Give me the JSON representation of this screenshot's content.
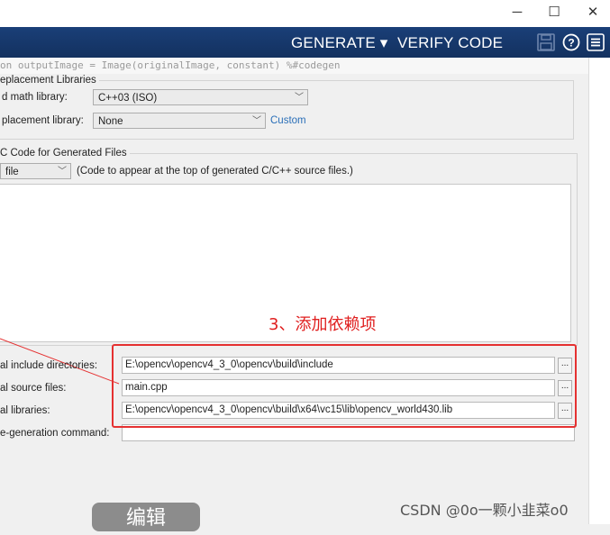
{
  "window": {
    "minimize_glyph": "─",
    "maximize_glyph": "☐",
    "close_glyph": "✕"
  },
  "toolbar": {
    "generate_label": "GENERATE ▾",
    "verify_label": "VERIFY CODE",
    "icons": [
      "save-icon",
      "help-icon",
      "menu-icon"
    ]
  },
  "code_strip": {
    "text": "on outputImage = Image(originalImage, constant) %#codegen"
  },
  "replacement": {
    "group_title": "eplacement Libraries",
    "math_label": "d math library:",
    "math_value": "C++03 (ISO)",
    "repl_label": "placement library:",
    "repl_value": "None",
    "custom_link": "Custom"
  },
  "comments": {
    "group_title": "C Code for Generated Files",
    "select_value": "file",
    "hint": "(Code to appear at the top of generated C/C++ source files.)"
  },
  "annotation": {
    "text": "3、添加依赖项",
    "color": "#e53131"
  },
  "build_fields": [
    {
      "label": "al include directories:",
      "value": "E:\\opencv\\opencv4_3_0\\opencv\\build\\include"
    },
    {
      "label": "al source files:",
      "value": "main.cpp"
    },
    {
      "label": "al libraries:",
      "value": "E:\\opencv\\opencv4_3_0\\opencv\\build\\x64\\vc15\\lib\\opencv_world430.lib"
    },
    {
      "label": "e-generation command:",
      "value": ""
    }
  ],
  "browse_label": "...",
  "edit_button": "编辑",
  "watermark": "CSDN @0o一颗小韭菜o0"
}
